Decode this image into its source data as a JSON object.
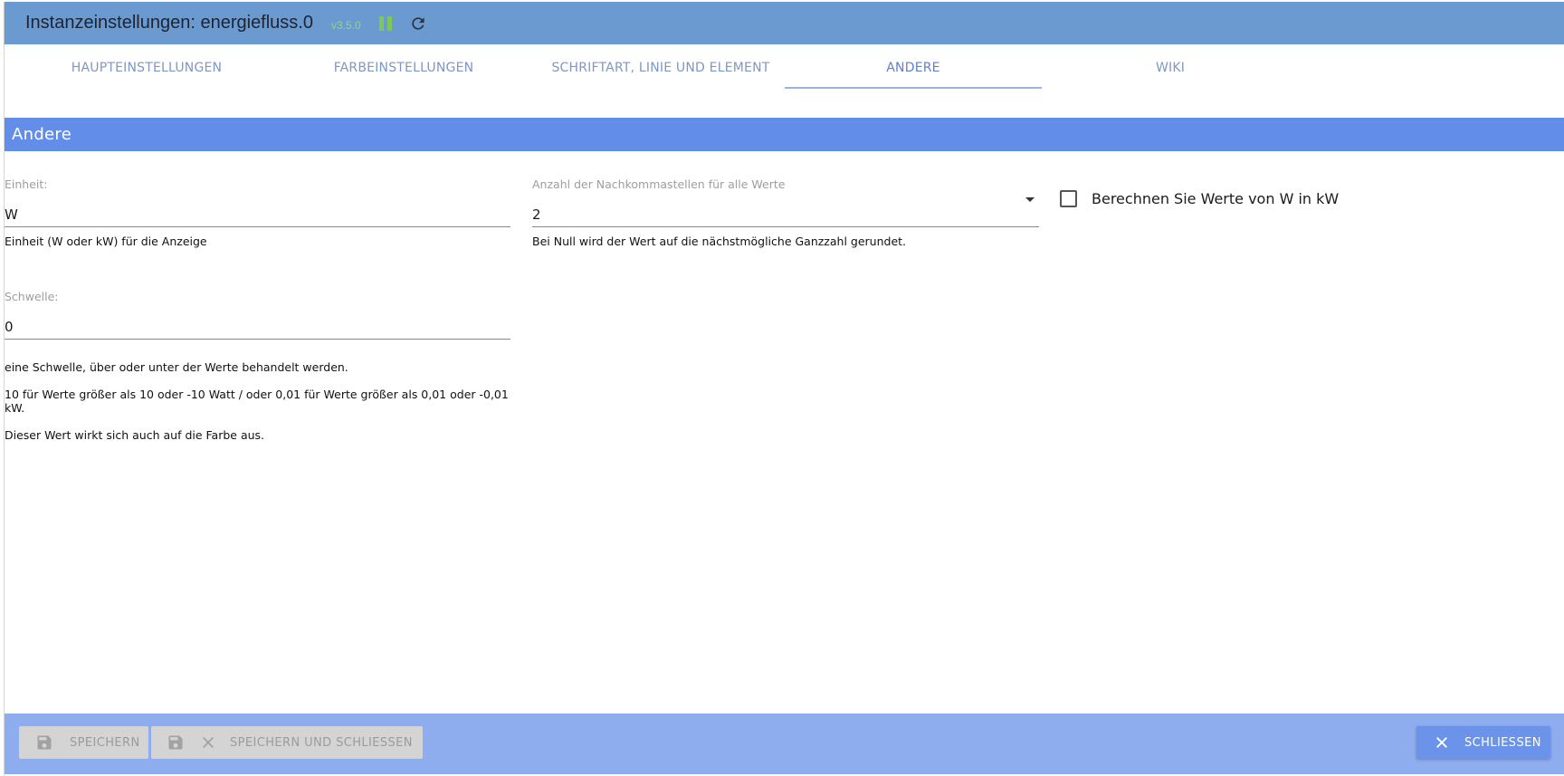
{
  "window": {
    "title": "Instanzeinstellungen: energiefluss.0",
    "version": "v3.5.0",
    "pause_icon": "pause-icon",
    "reload_icon": "reload-icon"
  },
  "tabs": [
    {
      "label": "HAUPTEINSTELLUNGEN",
      "active": false
    },
    {
      "label": "FARBEINSTELLUNGEN",
      "active": false
    },
    {
      "label": "SCHRIFTART, LINIE UND ELEMENT",
      "active": false
    },
    {
      "label": "ANDERE",
      "active": true
    },
    {
      "label": "WIKI",
      "active": false
    }
  ],
  "section": {
    "title": "Andere"
  },
  "fields": {
    "unit": {
      "label": "Einheit:",
      "value": "W",
      "helper": "Einheit (W oder kW) für die Anzeige"
    },
    "decimals": {
      "label": "Anzahl der Nachkommastellen für alle Werte",
      "value": "2",
      "helper": "Bei Null wird der Wert auf die nächstmögliche Ganzzahl gerundet."
    },
    "threshold": {
      "label": "Schwelle:",
      "value": "0",
      "helper_lines": [
        "eine Schwelle, über oder unter der Werte behandelt werden.",
        "10 für Werte größer als 10 oder -10 Watt / oder 0,01 für Werte größer als 0,01 oder -0,01 kW.",
        "Dieser Wert wirkt sich auch auf die Farbe aus."
      ]
    },
    "calc_kw": {
      "label": "Berechnen Sie Werte von W in kW",
      "checked": false
    }
  },
  "footer": {
    "save_label": "SPEICHERN",
    "save_close_label": "SPEICHERN UND SCHLIESSEN",
    "close_label": "SCHLIESSEN"
  },
  "colors": {
    "titlebar": "#6a9ad0",
    "section_header": "#628de9",
    "footer": "#8eadef",
    "version": "#8fdc6a",
    "accent": "#6b93ea"
  }
}
